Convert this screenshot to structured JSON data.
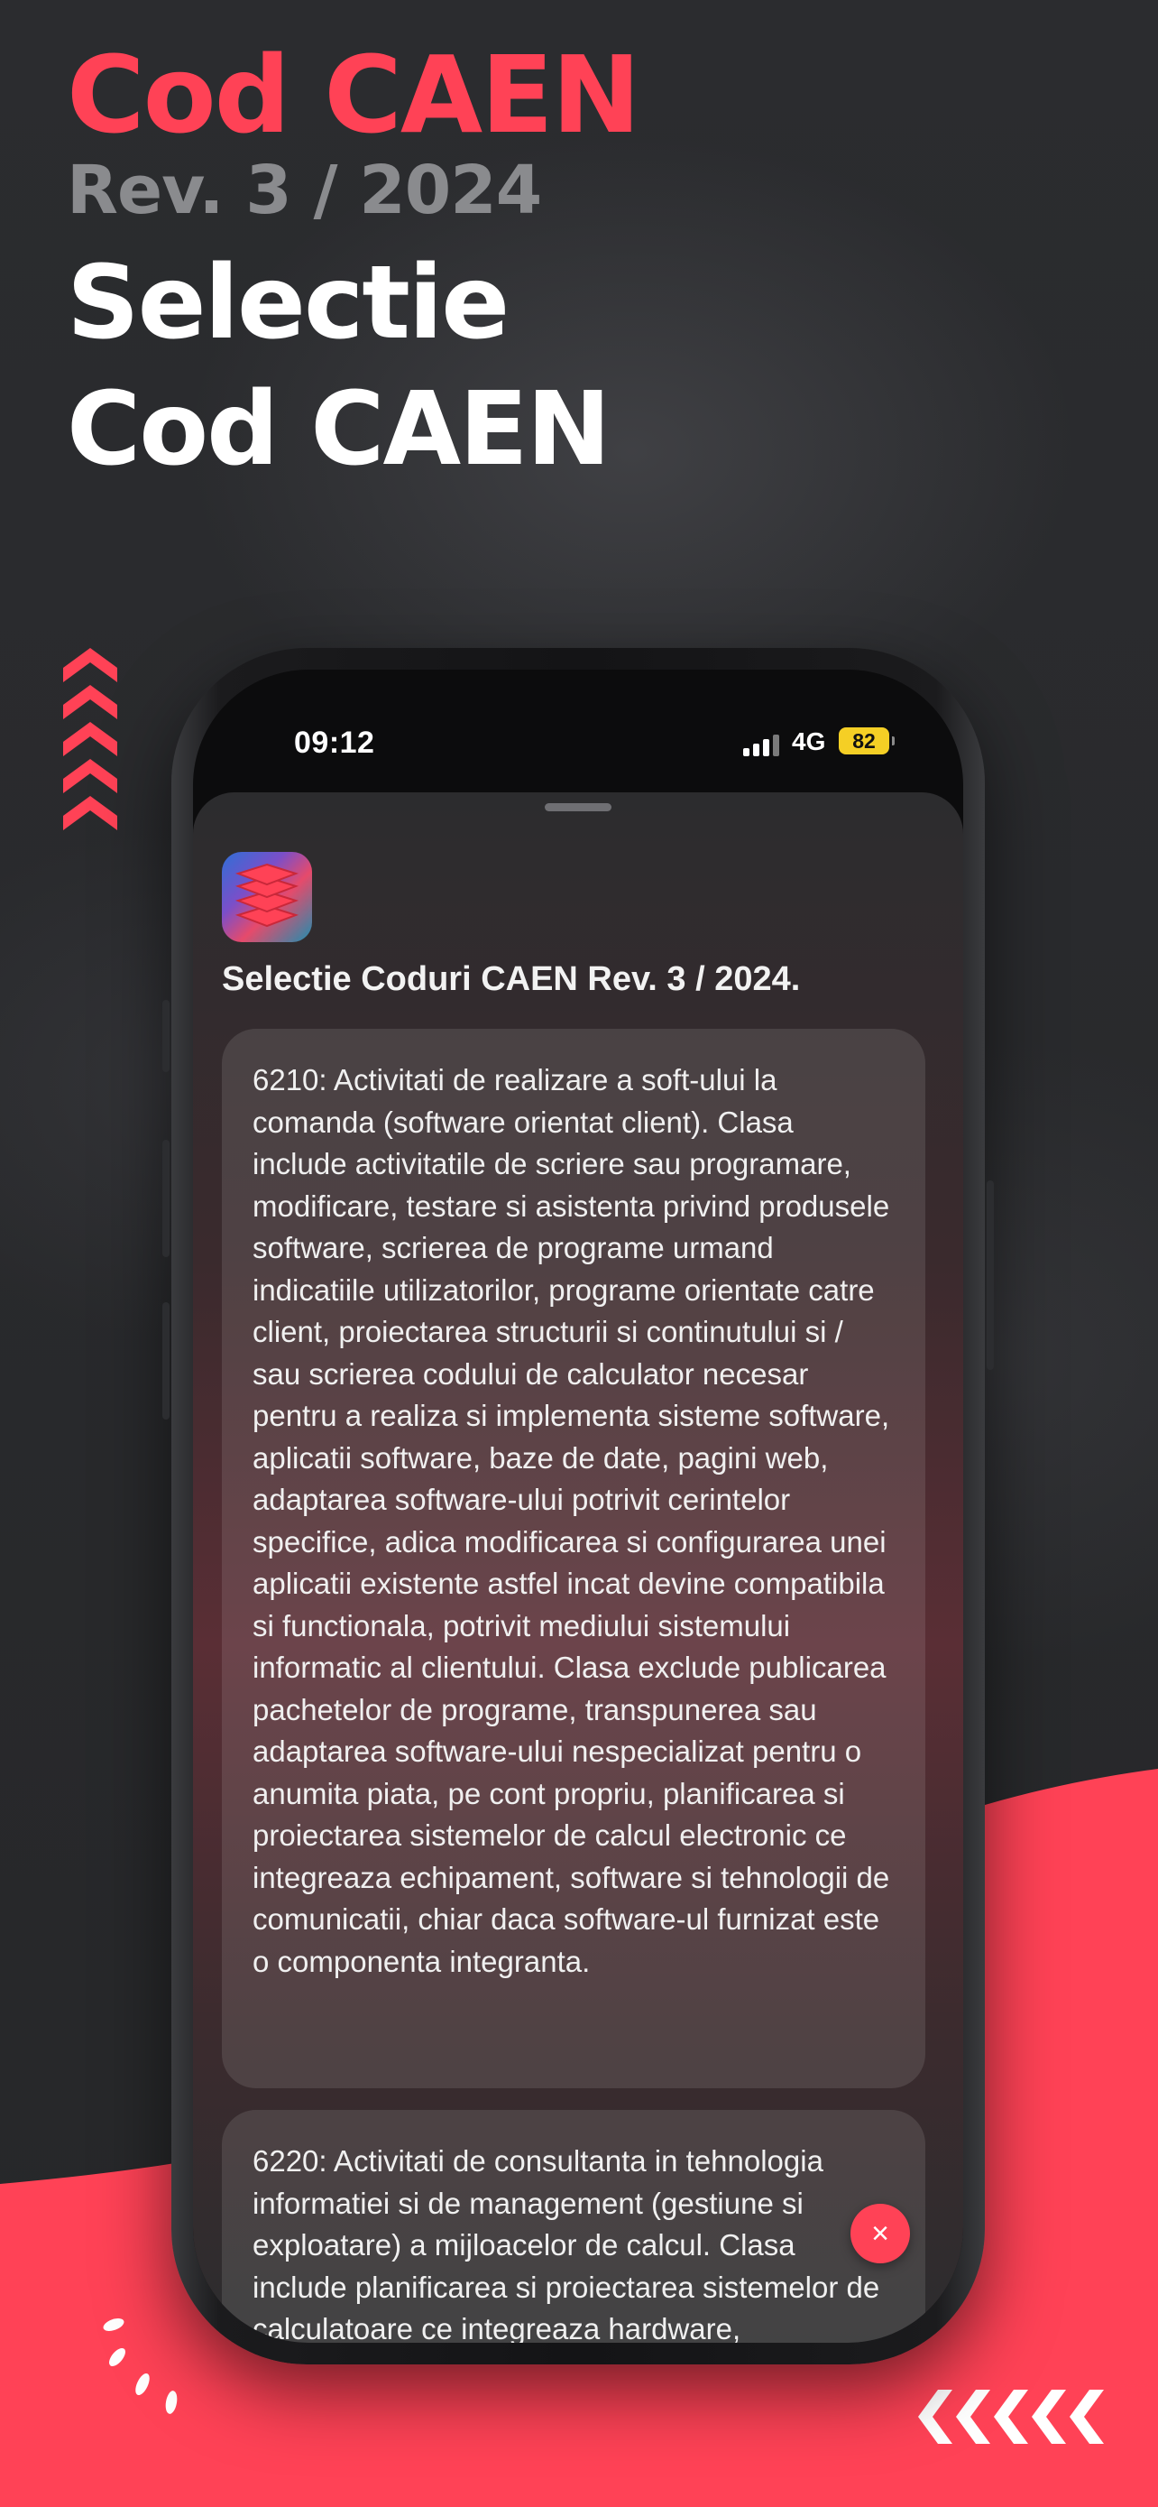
{
  "promo": {
    "line1": "Cod CAEN",
    "line2": "Rev. 3 / 2024",
    "line3a": "Selectie",
    "line3b": "Cod CAEN"
  },
  "colors": {
    "accent": "#ff4256",
    "battery": "#f5cf25"
  },
  "status_bar": {
    "time": "09:12",
    "network": "4G",
    "battery": "82",
    "icons": [
      "signal-icon",
      "battery-icon"
    ]
  },
  "sheet": {
    "title": "Selectie Coduri CAEN Rev. 3 / 2024.",
    "app_icon": "stacked-layers-icon",
    "cards": [
      {
        "text": "6210: Activitati de realizare a soft-ului la comanda (software orientat client). Clasa include activitatile de scriere sau programare, modificare, testare si asistenta privind produsele software, scrierea de programe urmand indicatiile utilizatorilor, programe orientate catre client, proiectarea structurii si continutului si / sau scrierea codului de calculator necesar pentru a realiza si implementa sisteme software, aplicatii software, baze de date, pagini web, adaptarea software-ului potrivit cerintelor specifice, adica modificarea si configurarea unei aplicatii existente astfel incat devine compatibila si functionala, potrivit mediului sistemului informatic al clientului. Clasa exclude publicarea pachetelor de programe, transpunerea sau adaptarea software-ului nespecializat pentru o anumita piata, pe cont propriu, planificarea si proiectarea sistemelor de calcul electronic ce integreaza echipament, software si tehnologii de comunicatii, chiar daca software-ul furnizat este o componenta integranta."
      },
      {
        "text": "6220: Activitati de consultanta in tehnologia informatiei si de management (gestiune si exploatare) a mijloacelor de calcul. Clasa include planificarea si proiectarea sistemelor de calculatoare ce integreaza hardware,"
      }
    ],
    "close_label": "×"
  }
}
